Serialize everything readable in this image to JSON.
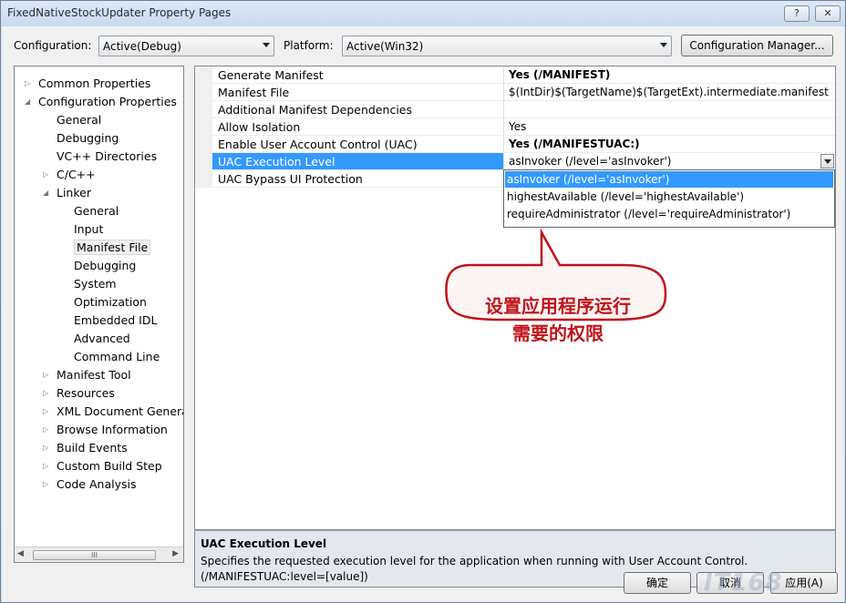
{
  "window": {
    "title": "FixedNativeStockUpdater Property Pages",
    "help_button": "?",
    "close_button": "✕"
  },
  "toolbar": {
    "configuration_label": "Configuration:",
    "configuration_value": "Active(Debug)",
    "platform_label": "Platform:",
    "platform_value": "Active(Win32)",
    "config_manager_button": "Configuration Manager..."
  },
  "tree": {
    "items": [
      {
        "label": "Common Properties",
        "level": 0,
        "expander": "closed"
      },
      {
        "label": "Configuration Properties",
        "level": 0,
        "expander": "open"
      },
      {
        "label": "General",
        "level": 1,
        "expander": "none"
      },
      {
        "label": "Debugging",
        "level": 1,
        "expander": "none"
      },
      {
        "label": "VC++ Directories",
        "level": 1,
        "expander": "none"
      },
      {
        "label": "C/C++",
        "level": 1,
        "expander": "closed"
      },
      {
        "label": "Linker",
        "level": 1,
        "expander": "open"
      },
      {
        "label": "General",
        "level": 2,
        "expander": "none"
      },
      {
        "label": "Input",
        "level": 2,
        "expander": "none"
      },
      {
        "label": "Manifest File",
        "level": 2,
        "expander": "none",
        "selected": true
      },
      {
        "label": "Debugging",
        "level": 2,
        "expander": "none"
      },
      {
        "label": "System",
        "level": 2,
        "expander": "none"
      },
      {
        "label": "Optimization",
        "level": 2,
        "expander": "none"
      },
      {
        "label": "Embedded IDL",
        "level": 2,
        "expander": "none"
      },
      {
        "label": "Advanced",
        "level": 2,
        "expander": "none"
      },
      {
        "label": "Command Line",
        "level": 2,
        "expander": "none"
      },
      {
        "label": "Manifest Tool",
        "level": 1,
        "expander": "closed"
      },
      {
        "label": "Resources",
        "level": 1,
        "expander": "closed"
      },
      {
        "label": "XML Document Generat",
        "level": 1,
        "expander": "closed"
      },
      {
        "label": "Browse Information",
        "level": 1,
        "expander": "closed"
      },
      {
        "label": "Build Events",
        "level": 1,
        "expander": "closed"
      },
      {
        "label": "Custom Build Step",
        "level": 1,
        "expander": "closed"
      },
      {
        "label": "Code Analysis",
        "level": 1,
        "expander": "closed"
      }
    ],
    "scroll_grip": "III"
  },
  "grid": {
    "rows": [
      {
        "name": "Generate Manifest",
        "value": "Yes (/MANIFEST)",
        "bold": true
      },
      {
        "name": "Manifest File",
        "value": "$(IntDir)$(TargetName)$(TargetExt).intermediate.manifest",
        "bold": false
      },
      {
        "name": "Additional Manifest Dependencies",
        "value": "",
        "bold": false
      },
      {
        "name": "Allow Isolation",
        "value": "Yes",
        "bold": false
      },
      {
        "name": "Enable User Account Control (UAC)",
        "value": "Yes (/MANIFESTUAC:)",
        "bold": true
      },
      {
        "name": "UAC Execution Level",
        "value": "asInvoker (/level='asInvoker')",
        "bold": false,
        "highlighted": true
      },
      {
        "name": "UAC Bypass UI Protection",
        "value": "",
        "bold": false
      }
    ],
    "dropdown_options": [
      "asInvoker (/level='asInvoker')",
      "highestAvailable (/level='highestAvailable')",
      "requireAdministrator (/level='requireAdministrator')"
    ]
  },
  "description": {
    "title": "UAC Execution Level",
    "body": "Specifies the requested execution level for the application when running with User Account Control. (/MANIFESTUAC:level=[value])"
  },
  "callout": {
    "line1": "设置应用程序运行",
    "line2": "需要的权限"
  },
  "buttons": {
    "ok": "确定",
    "cancel": "取消",
    "apply": "应用(A)"
  },
  "watermark": "IT168"
}
